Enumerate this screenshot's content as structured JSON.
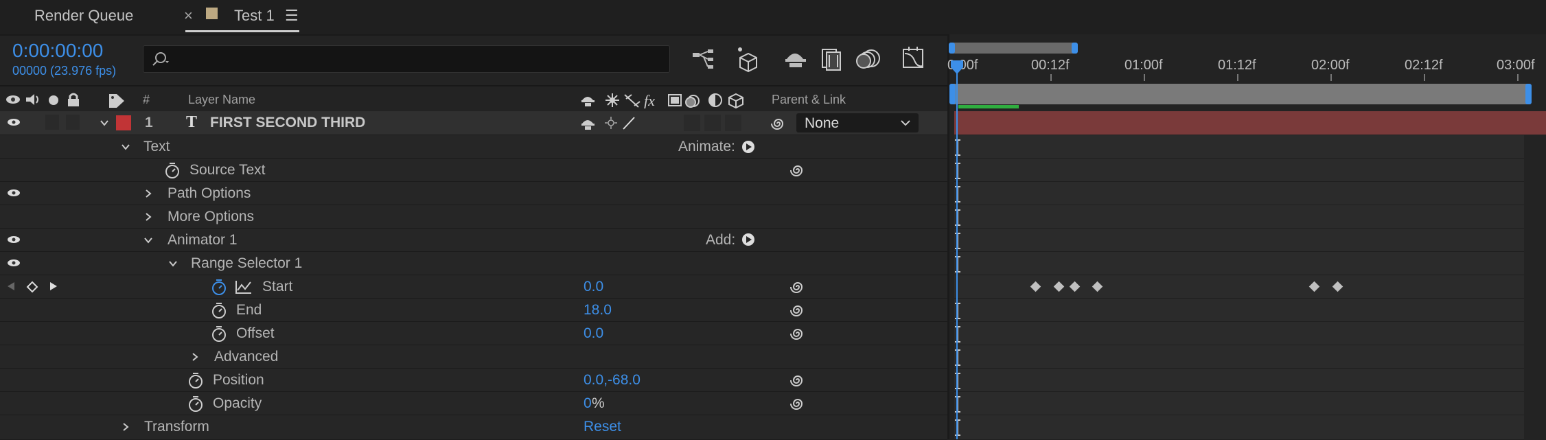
{
  "tabs": [
    {
      "label": "Render Queue"
    },
    {
      "label": "Test 1"
    }
  ],
  "tab_close_glyph": "×",
  "tab_menu_glyph": "☰",
  "timecode": "0:00:00:00",
  "frame_info": "00000 (23.976 fps)",
  "columns": {
    "number": "#",
    "layer_name": "Layer Name",
    "parent_link": "Parent & Link"
  },
  "layer": {
    "number": "1",
    "name": "FIRST SECOND THIRD",
    "type_glyph": "T",
    "parent": "None",
    "label_color": "#c13436"
  },
  "properties": [
    {
      "label": "Text",
      "value": "",
      "extra": "Animate:"
    },
    {
      "label": "Source Text",
      "value": ""
    },
    {
      "label": "Path Options",
      "value": ""
    },
    {
      "label": "More Options",
      "value": ""
    },
    {
      "label": "Animator 1",
      "value": "",
      "extra": "Add:"
    },
    {
      "label": "Range Selector 1",
      "value": ""
    },
    {
      "label": "Start",
      "value": "0.0"
    },
    {
      "label": "End",
      "value": "18.0"
    },
    {
      "label": "Offset",
      "value": "0.0"
    },
    {
      "label": "Advanced",
      "value": ""
    },
    {
      "label": "Position",
      "value": "0.0,-68.0"
    },
    {
      "label": "Opacity",
      "value": "0",
      "unit": "%"
    },
    {
      "label": "Transform",
      "value": "Reset"
    }
  ],
  "ruler": [
    "0:00f",
    "00:12f",
    "01:00f",
    "01:12f",
    "02:00f",
    "02:12f",
    "03:00f"
  ],
  "accent_color": "#3d8fe8",
  "layer_bar_color": "#7a3a3a"
}
